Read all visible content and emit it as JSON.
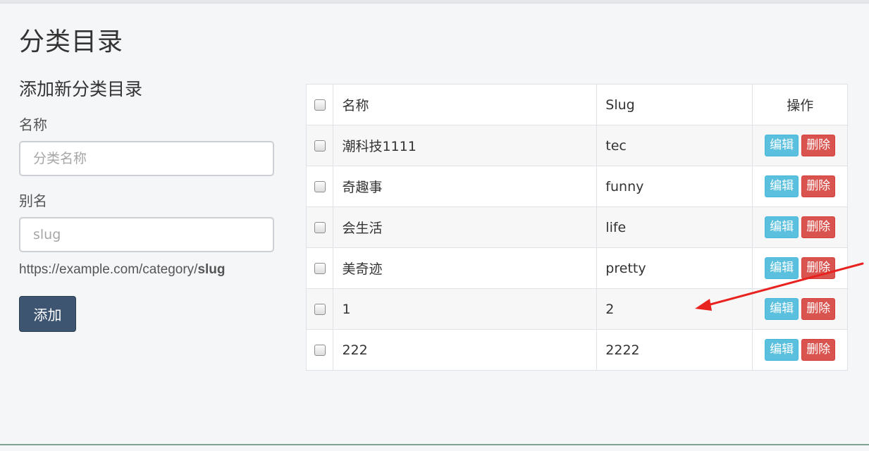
{
  "page": {
    "title": "分类目录"
  },
  "form": {
    "heading": "添加新分类目录",
    "name_label": "名称",
    "name_placeholder": "分类名称",
    "slug_label": "别名",
    "slug_placeholder": "slug",
    "url_prefix": "https://example.com/category/",
    "url_suffix": "slug",
    "submit_label": "添加"
  },
  "table": {
    "headers": {
      "name": "名称",
      "slug": "Slug",
      "actions": "操作"
    },
    "edit_label": "编辑",
    "delete_label": "删除",
    "rows": [
      {
        "name": "潮科技1111",
        "slug": "tec"
      },
      {
        "name": "奇趣事",
        "slug": "funny"
      },
      {
        "name": "会生活",
        "slug": "life"
      },
      {
        "name": "美奇迹",
        "slug": "pretty"
      },
      {
        "name": "1",
        "slug": "2"
      },
      {
        "name": "222",
        "slug": "2222"
      }
    ]
  },
  "colors": {
    "primary_button": "#3d5570",
    "edit_button": "#5bc0de",
    "delete_button": "#d9534f",
    "annotation_arrow": "#e8231f"
  }
}
